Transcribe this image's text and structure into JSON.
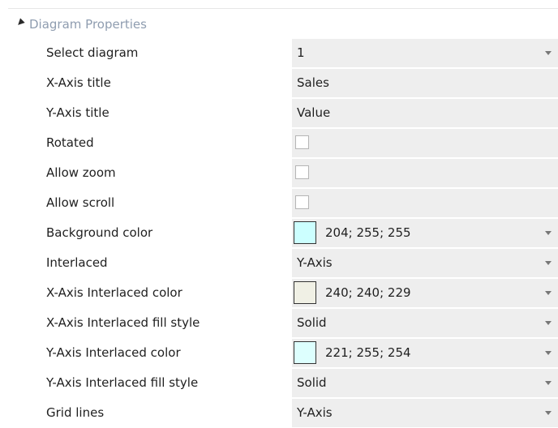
{
  "section": {
    "title": "Diagram Properties"
  },
  "rows": [
    {
      "label": "Select diagram",
      "value": "1"
    },
    {
      "label": "X-Axis title",
      "value": "Sales"
    },
    {
      "label": "Y-Axis title",
      "value": "Value"
    },
    {
      "label": "Rotated",
      "checked": false
    },
    {
      "label": "Allow zoom",
      "checked": false
    },
    {
      "label": "Allow scroll",
      "checked": false
    },
    {
      "label": "Background color",
      "value": "204; 255; 255",
      "color": "#ccffff"
    },
    {
      "label": "Interlaced",
      "value": "Y-Axis"
    },
    {
      "label": "X-Axis Interlaced color",
      "value": "240; 240; 229",
      "color": "#f0f0e5"
    },
    {
      "label": "X-Axis Interlaced fill style",
      "value": "Solid"
    },
    {
      "label": "Y-Axis Interlaced color",
      "value": "221; 255; 254",
      "color": "#ddfffe"
    },
    {
      "label": "Y-Axis Interlaced fill style",
      "value": "Solid"
    },
    {
      "label": "Grid lines",
      "value": "Y-Axis"
    }
  ],
  "icons": {
    "section_expander": "expanded-triangle-icon",
    "dropdown": "chevron-down-icon"
  }
}
